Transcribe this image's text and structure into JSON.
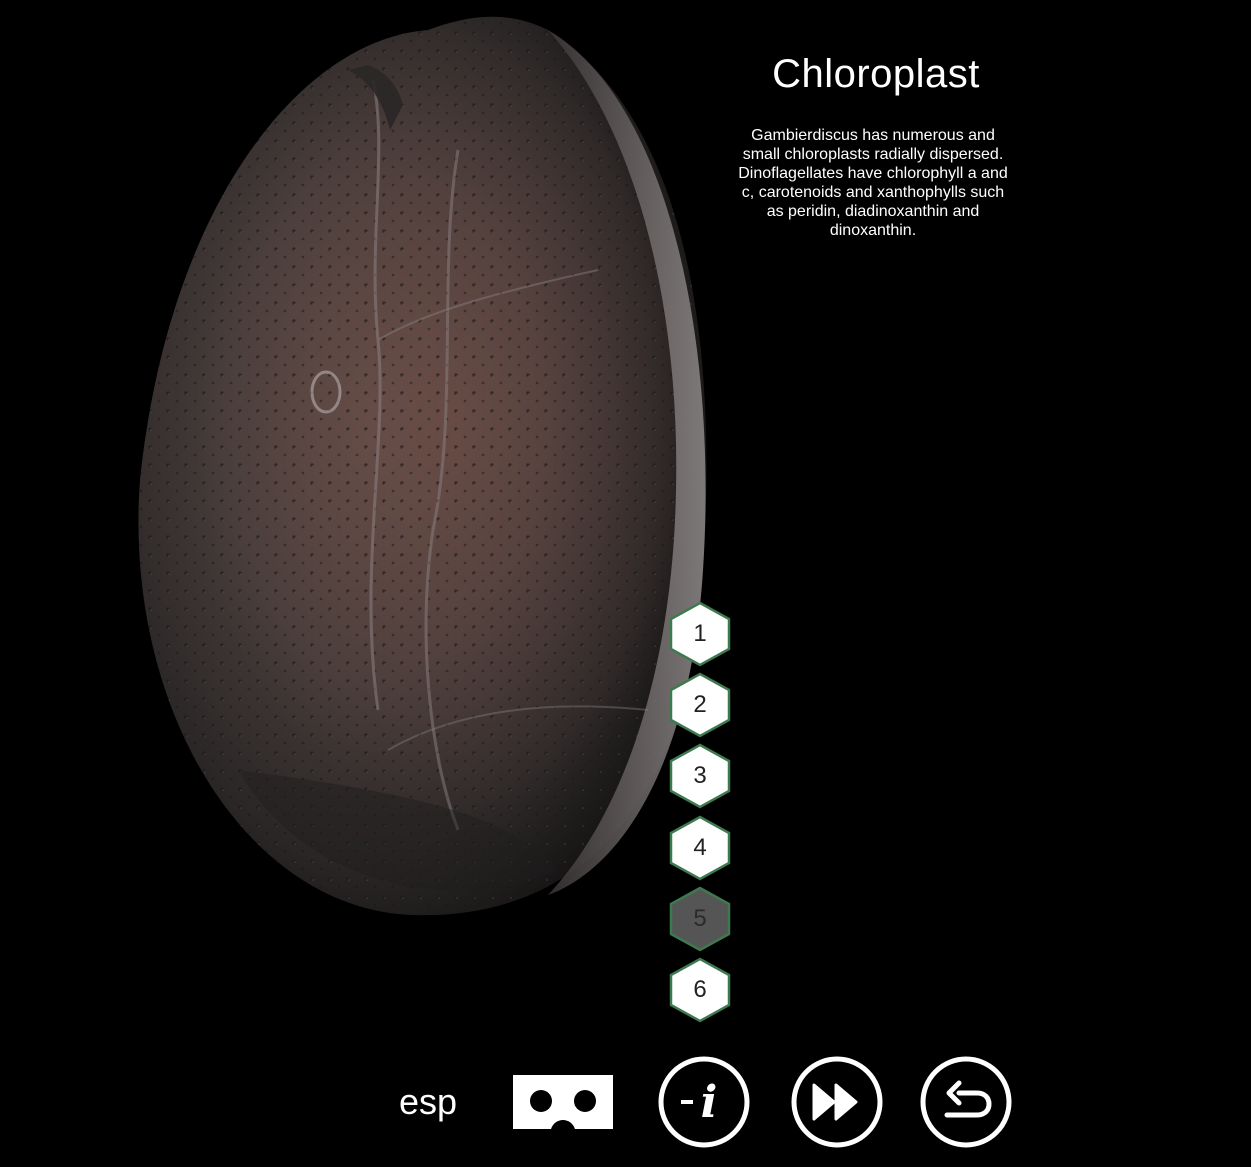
{
  "info": {
    "title": "Chloroplast",
    "description": "Gambierdiscus has numerous and small chloroplasts radially dispersed. Dinoflagellates have chlorophyll a and c, carotenoids and xanthophylls such as peridin, diadinoxanthin and dinoxanthin."
  },
  "steps": [
    {
      "label": "1",
      "active": false
    },
    {
      "label": "2",
      "active": false
    },
    {
      "label": "3",
      "active": false
    },
    {
      "label": "4",
      "active": false
    },
    {
      "label": "5",
      "active": true
    },
    {
      "label": "6",
      "active": false
    }
  ],
  "toolbar": {
    "language_label": "esp",
    "buttons": [
      {
        "name": "vr-headset-icon"
      },
      {
        "name": "info-icon"
      },
      {
        "name": "fast-forward-icon"
      },
      {
        "name": "back-arrow-icon"
      }
    ]
  },
  "colors": {
    "background": "#000000",
    "hex_border": "#3e7a4f",
    "hex_fill": "#ffffff",
    "hex_active_fill": "#555555",
    "text": "#ffffff"
  }
}
